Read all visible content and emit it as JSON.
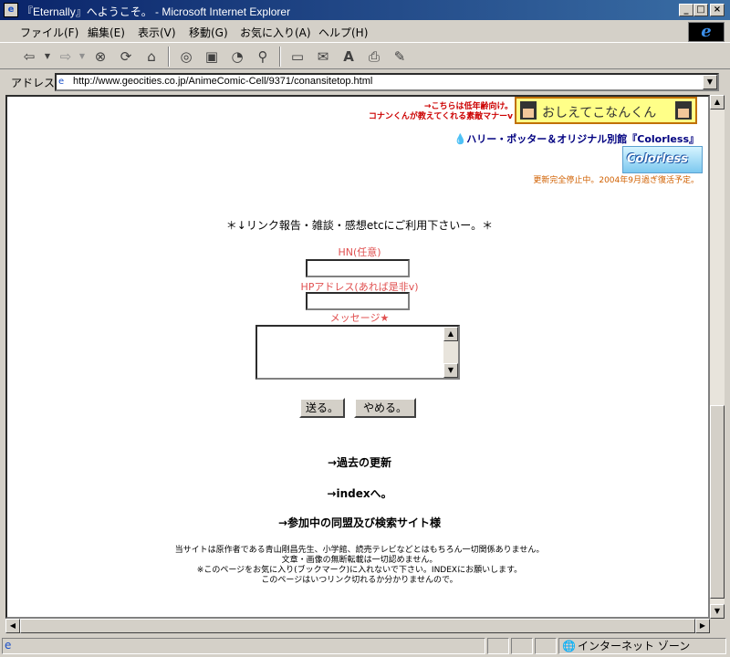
{
  "window": {
    "title": "『Eternally』へようこそ。 - Microsoft Internet Explorer"
  },
  "menu": {
    "items": [
      "ファイル(F)",
      "編集(E)",
      "表示(V)",
      "移動(G)",
      "お気に入り(A)",
      "ヘルプ(H)"
    ]
  },
  "toolbar": {
    "icons": [
      "back-icon",
      "forward-icon",
      "stop-icon",
      "refresh-icon",
      "home-icon",
      "search-icon",
      "favorites-icon",
      "history-icon",
      "channels-icon",
      "fullscreen-icon",
      "mail-icon",
      "font-icon",
      "print-icon",
      "edit-icon"
    ]
  },
  "address": {
    "label": "アドレス",
    "url": "http://www.geocities.co.jp/AnimeComic-Cell/9371/conansitetop.html"
  },
  "page": {
    "banner_note_1": "→こちらは低年齢向け。",
    "banner_note_2": "コナンくんが教えてくれる素敵マナーv",
    "banner_text": "おしえてこなんくん",
    "harry_link": "ハリー・ポッター＆オリジナル別館『Colorless』",
    "colorless_banner": "Colorless",
    "stop_note": "更新完全停止中。2004年9月過ぎ復活予定。",
    "intro": "＊↓リンク報告・雑談・感想etcにご利用下さいー。＊",
    "form": {
      "hn_label": "HN(任意)",
      "hp_label": "HPアドレス(あれば是非v)",
      "message_label": "メッセージ★",
      "hn_value": "",
      "hp_value": "",
      "message_value": "",
      "send_label": "送る。",
      "cancel_label": "やめる。"
    },
    "links": {
      "past_updates": "→過去の更新",
      "index": "→indexへ。",
      "alliances": "→参加中の同盟及び検索サイト様"
    },
    "footer": {
      "line1": "当サイトは原作者である青山剛昌先生、小学館、読売テレビなどとはもちろん一切関係ありません。",
      "line2": "文章・画像の無断転載は一切認めません。",
      "line3": "※このページをお気に入り(ブックマーク)に入れないで下さい。INDEXにお願いします。",
      "line4": "このページはいつリンク切れるか分かりませんので。"
    }
  },
  "status": {
    "zone": "インターネット ゾーン"
  },
  "colors": {
    "title_bar": "#0a246a",
    "chrome": "#d4d0c8",
    "form_label": "#e05050",
    "banner_note": "#cc0000",
    "stop_note": "#d06000"
  }
}
